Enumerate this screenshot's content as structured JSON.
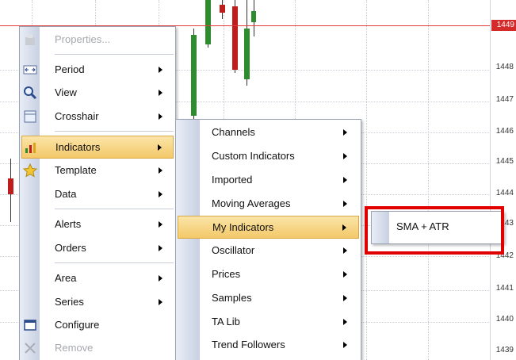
{
  "price_axis": {
    "current_price": "1449",
    "ticks": [
      "1448",
      "1447",
      "1446",
      "1445",
      "1444",
      "1443",
      "1442",
      "1441",
      "1440",
      "1439"
    ]
  },
  "context_menu": {
    "items": [
      {
        "label": "Properties...",
        "icon": "properties-icon",
        "disabled": true
      },
      {
        "label": "Period",
        "icon": "period-icon",
        "submenu": true
      },
      {
        "label": "View",
        "icon": "magnifier-icon",
        "submenu": true
      },
      {
        "label": "Crosshair",
        "icon": "crosshair-icon",
        "submenu": true
      },
      {
        "label": "Indicators",
        "icon": "indicators-icon",
        "submenu": true,
        "highlighted": true
      },
      {
        "label": "Template",
        "icon": "star-icon",
        "submenu": true
      },
      {
        "label": "Data",
        "submenu": true
      },
      {
        "label": "Alerts",
        "submenu": true
      },
      {
        "label": "Orders",
        "submenu": true
      },
      {
        "label": "Area",
        "submenu": true
      },
      {
        "label": "Series",
        "submenu": true
      },
      {
        "label": "Configure",
        "icon": "window-icon"
      },
      {
        "label": "Remove",
        "icon": "close-icon",
        "disabled": true
      }
    ]
  },
  "indicators_menu": {
    "items": [
      {
        "label": "Channels"
      },
      {
        "label": "Custom Indicators"
      },
      {
        "label": "Imported"
      },
      {
        "label": "Moving Averages"
      },
      {
        "label": "My Indicators",
        "highlighted": true
      },
      {
        "label": "Oscillator"
      },
      {
        "label": "Prices"
      },
      {
        "label": "Samples"
      },
      {
        "label": "TA Lib"
      },
      {
        "label": "Trend Followers"
      }
    ]
  },
  "my_indicators_menu": {
    "items": [
      {
        "label": "SMA + ATR"
      }
    ]
  },
  "colors": {
    "accent_highlight": "#f3c869",
    "price_line": "#e23b3b",
    "callout_border": "#e00000",
    "candle_up": "#2e8b2e",
    "candle_down": "#c01c1c"
  }
}
